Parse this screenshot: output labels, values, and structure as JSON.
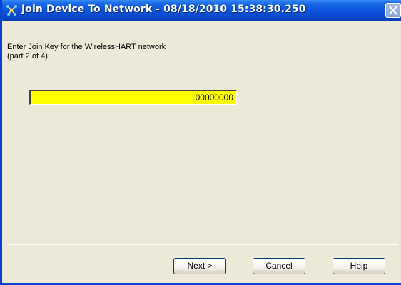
{
  "window": {
    "title": "Join Device To Network - 08/18/2010 15:38:30.250",
    "icon": "network-app-icon",
    "close_icon": "close-icon"
  },
  "prompt": {
    "line1": "Enter Join Key for the WirelessHART network",
    "line2": "(part 2 of 4):"
  },
  "join_key": {
    "value": "00000000"
  },
  "buttons": {
    "next": "Next >",
    "cancel": "Cancel",
    "help": "Help"
  },
  "colors": {
    "titlebar": "#0b52d8",
    "dialog_bg": "#ece9d8",
    "field_bg": "#ffff00"
  }
}
